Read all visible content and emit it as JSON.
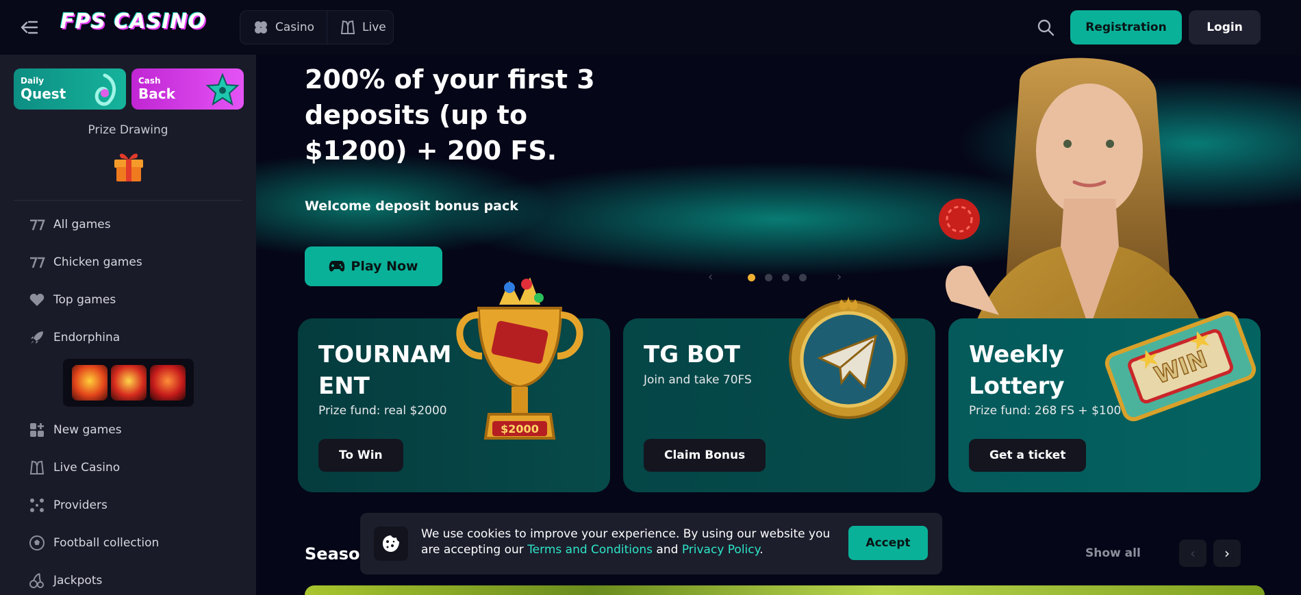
{
  "header": {
    "logo": "FPS CASINO",
    "nav": [
      {
        "label": "Casino",
        "icon": "clover-icon"
      },
      {
        "label": "Live",
        "icon": "dealer-icon"
      }
    ],
    "registration_label": "Registration",
    "login_label": "Login"
  },
  "sidebar": {
    "promos": [
      {
        "small": "Daily",
        "big": "Quest",
        "color": "#0fa38f"
      },
      {
        "small": "Cash",
        "big": "Back",
        "color": "#d63ae8"
      }
    ],
    "prize_drawing": "Prize Drawing",
    "items": [
      {
        "label": "All games",
        "icon": "seven-seven-icon"
      },
      {
        "label": "Chicken games",
        "icon": "seven-seven-icon"
      },
      {
        "label": "Top games",
        "icon": "heart-icon"
      },
      {
        "label": "Endorphina",
        "icon": "rocket-icon"
      },
      {
        "label": "New games",
        "icon": "grid-plus-icon"
      },
      {
        "label": "Live Casino",
        "icon": "dealer-icon"
      },
      {
        "label": "Providers",
        "icon": "dots-icon"
      },
      {
        "label": "Football collection",
        "icon": "football-icon"
      },
      {
        "label": "Jackpots",
        "icon": "cherries-icon"
      }
    ]
  },
  "hero": {
    "title": "200% of your first 3 deposits (up to $1200) + 200 FS.",
    "subtitle": "Welcome deposit bonus pack",
    "play_label": "Play Now",
    "slides": 4,
    "active_slide": 1
  },
  "cards": [
    {
      "title": "TOURNAMENT",
      "subtitle": "Prize fund: real $2000",
      "button": "To Win"
    },
    {
      "title": "TG BOT",
      "subtitle": "Join and take 70FS",
      "button": "Claim Bonus"
    },
    {
      "title": "Weekly Lottery",
      "subtitle": "Prize fund: 268 FS + $100",
      "button": "Get a ticket"
    }
  ],
  "section": {
    "title": "Season",
    "show_all": "Show all"
  },
  "cookie": {
    "text_before": "We use cookies to improve your experience. By using our website you are accepting our ",
    "terms": "Terms and Conditions",
    "and": " and ",
    "privacy": "Privacy Policy",
    "end": ".",
    "accept_label": "Accept"
  },
  "colors": {
    "accent": "#0ab199",
    "background": "#050617",
    "sidebar": "#1a1b29",
    "active_dot": "#f0b133"
  }
}
